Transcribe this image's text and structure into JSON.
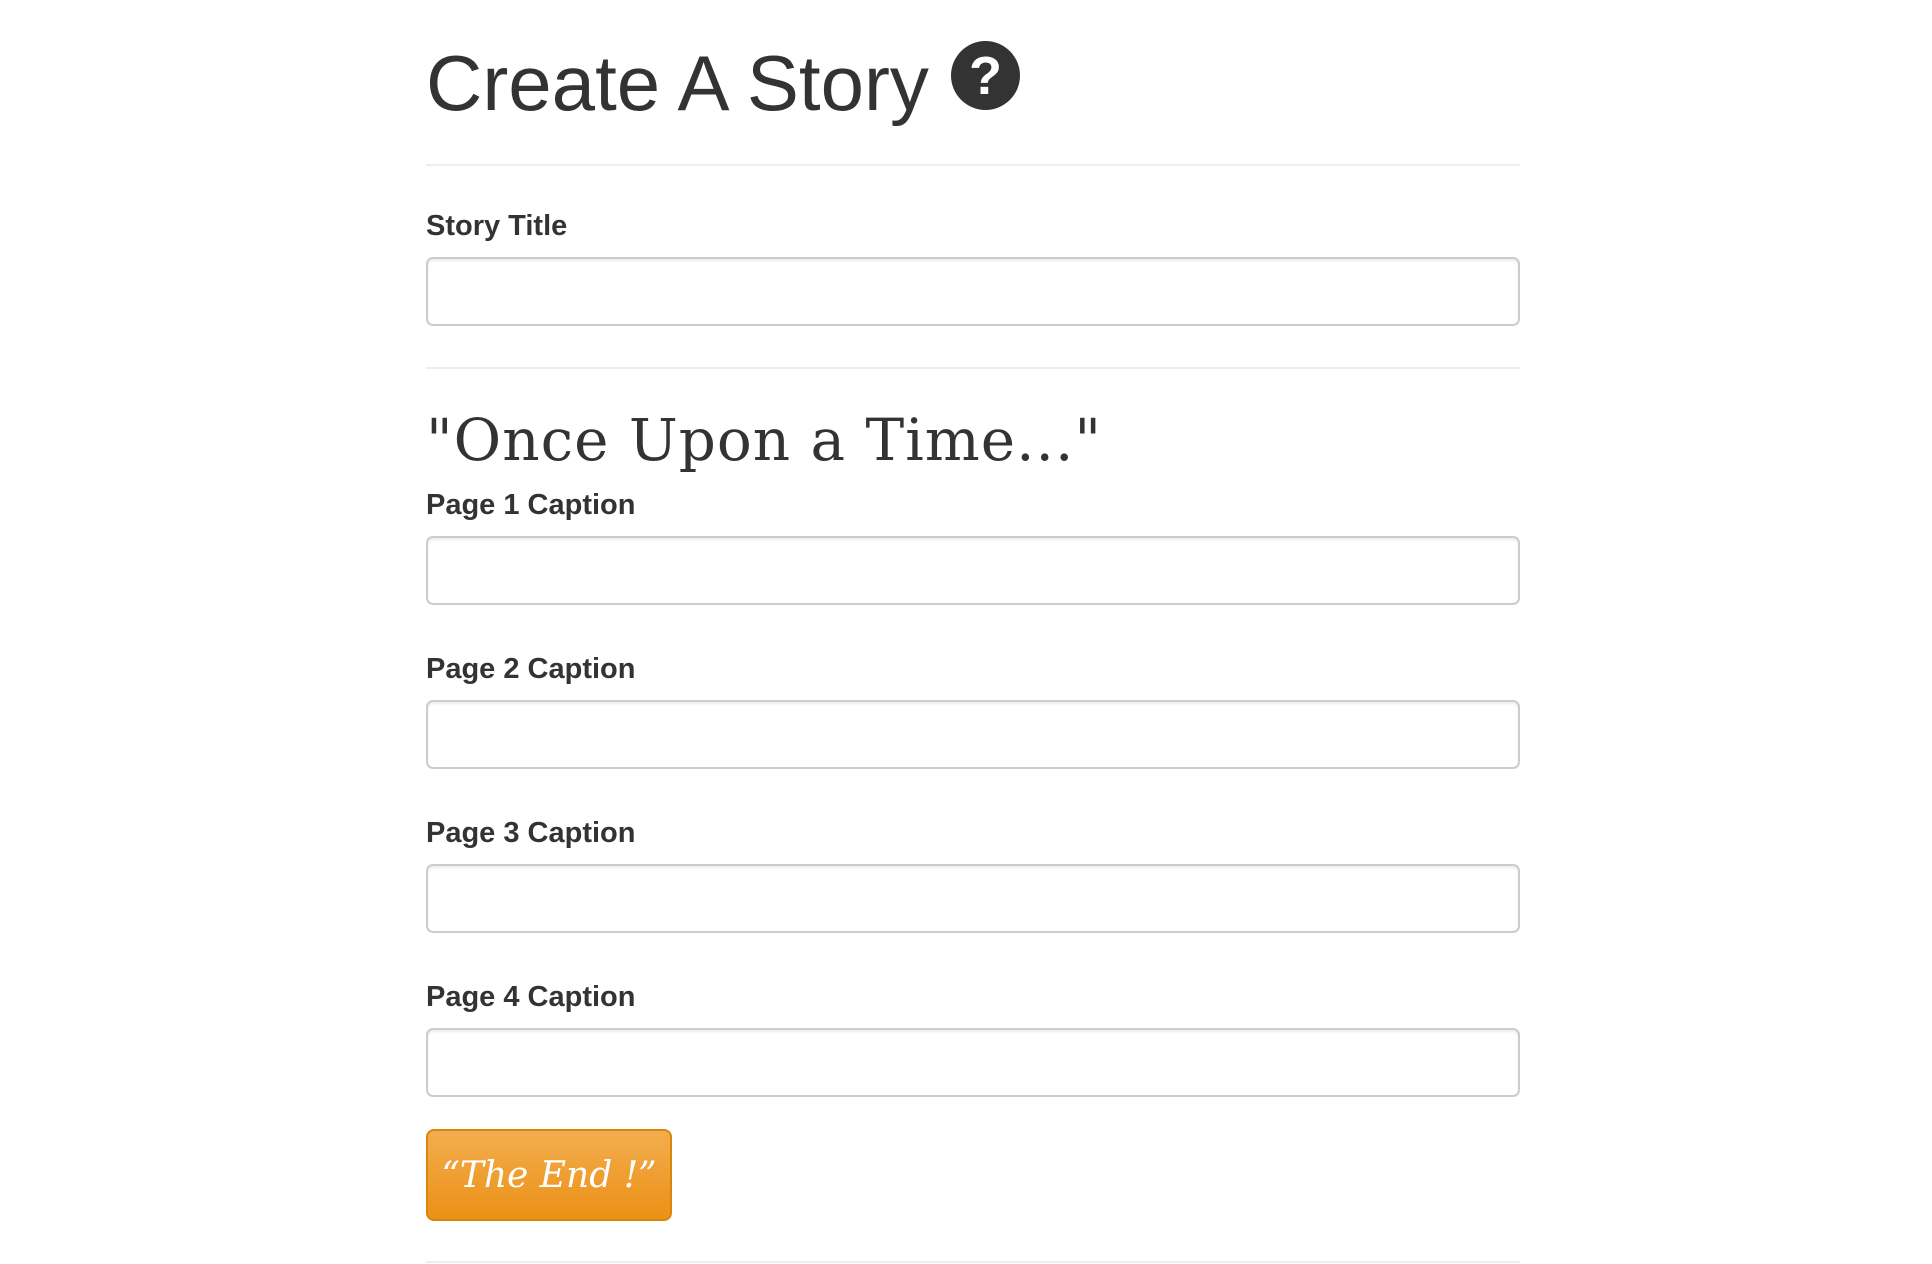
{
  "header": {
    "title": "Create A Story",
    "help_icon": "question-circle-icon",
    "help_symbol": "?"
  },
  "story_title": {
    "label": "Story Title",
    "value": "",
    "placeholder": ""
  },
  "section": {
    "heading": "\"Once Upon a Time...\""
  },
  "captions": [
    {
      "label": "Page 1 Caption",
      "value": "",
      "placeholder": ""
    },
    {
      "label": "Page 2 Caption",
      "value": "",
      "placeholder": ""
    },
    {
      "label": "Page 3 Caption",
      "value": "",
      "placeholder": ""
    },
    {
      "label": "Page 4 Caption",
      "value": "",
      "placeholder": ""
    }
  ],
  "submit": {
    "label": "“The End !”",
    "color": "#ef9d2f"
  }
}
